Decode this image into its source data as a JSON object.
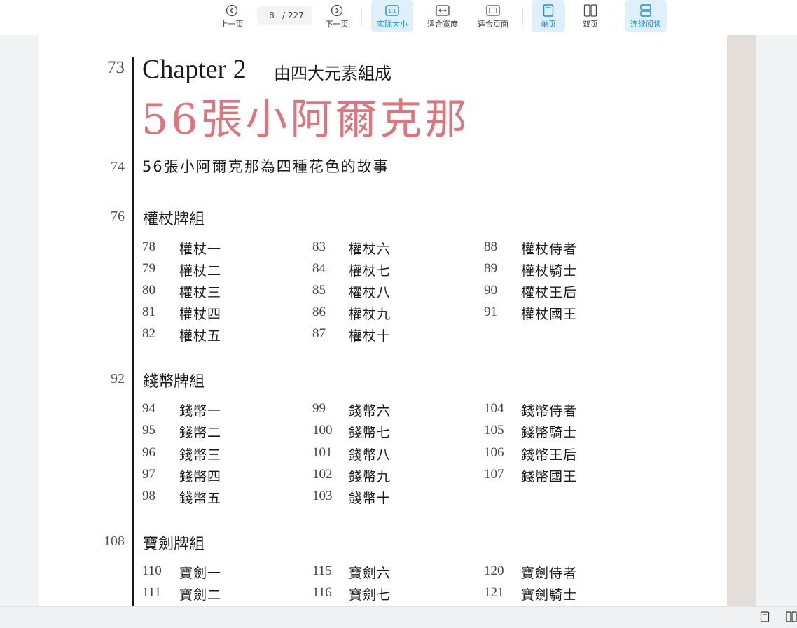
{
  "toolbar": {
    "prev_label": "上一页",
    "page_current": "8",
    "page_total": "/ 227",
    "next_label": "下一页",
    "actual_size_label": "实际大小",
    "fit_width_label": "适合宽度",
    "fit_page_label": "适合页面",
    "single_page_label": "单页",
    "double_page_label": "双页",
    "continuous_label": "连续阅读",
    "accent_color": "#1d8fd6",
    "active_bg": "#dff0fb"
  },
  "document": {
    "chapter_page": "73",
    "chapter_label": "Chapter 2",
    "chapter_subtitle": "由四大元素組成",
    "main_title": "56張小阿爾克那",
    "title_color": "#e0737c",
    "intro_page": "74",
    "intro_title": "56張小阿爾克那為四種花色的故事",
    "sections": [
      {
        "page": "76",
        "title": "權杖牌組",
        "entries": [
          {
            "n": "78",
            "t": "權杖一"
          },
          {
            "n": "79",
            "t": "權杖二"
          },
          {
            "n": "80",
            "t": "權杖三"
          },
          {
            "n": "81",
            "t": "權杖四"
          },
          {
            "n": "82",
            "t": "權杖五"
          },
          {
            "n": "83",
            "t": "權杖六"
          },
          {
            "n": "84",
            "t": "權杖七"
          },
          {
            "n": "85",
            "t": "權杖八"
          },
          {
            "n": "86",
            "t": "權杖九"
          },
          {
            "n": "87",
            "t": "權杖十"
          },
          {
            "n": "88",
            "t": "權杖侍者"
          },
          {
            "n": "89",
            "t": "權杖騎士"
          },
          {
            "n": "90",
            "t": "權杖王后"
          },
          {
            "n": "91",
            "t": "權杖國王"
          }
        ]
      },
      {
        "page": "92",
        "title": "錢幣牌組",
        "entries": [
          {
            "n": "94",
            "t": "錢幣一"
          },
          {
            "n": "95",
            "t": "錢幣二"
          },
          {
            "n": "96",
            "t": "錢幣三"
          },
          {
            "n": "97",
            "t": "錢幣四"
          },
          {
            "n": "98",
            "t": "錢幣五"
          },
          {
            "n": "99",
            "t": "錢幣六"
          },
          {
            "n": "100",
            "t": "錢幣七"
          },
          {
            "n": "101",
            "t": "錢幣八"
          },
          {
            "n": "102",
            "t": "錢幣九"
          },
          {
            "n": "103",
            "t": "錢幣十"
          },
          {
            "n": "104",
            "t": "錢幣侍者"
          },
          {
            "n": "105",
            "t": "錢幣騎士"
          },
          {
            "n": "106",
            "t": "錢幣王后"
          },
          {
            "n": "107",
            "t": "錢幣國王"
          }
        ]
      },
      {
        "page": "108",
        "title": "寶劍牌組",
        "entries": [
          {
            "n": "110",
            "t": "寶劍一"
          },
          {
            "n": "111",
            "t": "寶劍二"
          },
          {
            "n": "115",
            "t": "寶劍六"
          },
          {
            "n": "116",
            "t": "寶劍七"
          },
          {
            "n": "120",
            "t": "寶劍侍者"
          },
          {
            "n": "121",
            "t": "寶劍騎士"
          }
        ]
      }
    ]
  }
}
